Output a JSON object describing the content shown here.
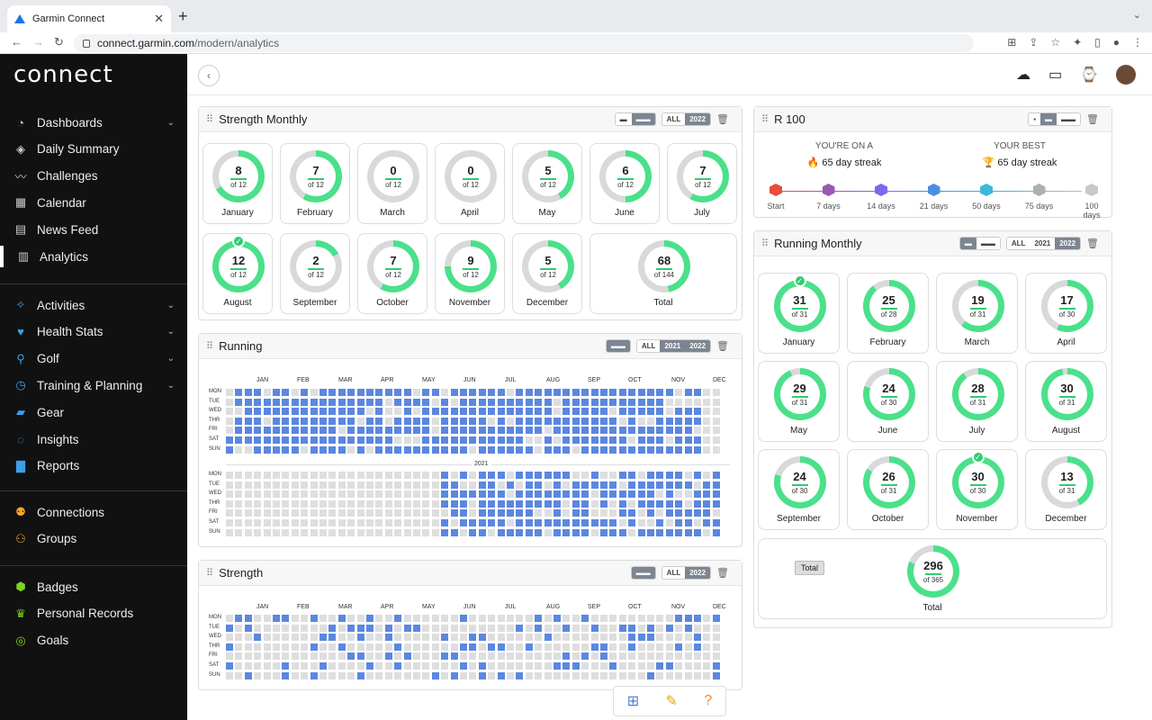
{
  "browser": {
    "tab_title": "Garmin Connect",
    "url_host": "connect.garmin.com",
    "url_path": "/modern/analytics"
  },
  "sidebar": {
    "logo": "connect",
    "groups": [
      [
        {
          "label": "Dashboards",
          "icon": "dashboards-icon",
          "glyph": "◔",
          "chev": true
        },
        {
          "label": "Daily Summary",
          "icon": "layers-icon",
          "glyph": "◈"
        },
        {
          "label": "Challenges",
          "icon": "challenges-icon",
          "glyph": "〰"
        },
        {
          "label": "Calendar",
          "icon": "calendar-icon",
          "glyph": "▦"
        },
        {
          "label": "News Feed",
          "icon": "newsfeed-icon",
          "glyph": "▤"
        },
        {
          "label": "Analytics",
          "icon": "analytics-icon",
          "glyph": "▥",
          "active": true
        }
      ],
      [
        {
          "label": "Activities",
          "icon": "activities-icon",
          "glyph": "✧",
          "chev": true,
          "color": "#3ba0e6"
        },
        {
          "label": "Health Stats",
          "icon": "heart-icon",
          "glyph": "♥",
          "chev": true,
          "color": "#3ba0e6"
        },
        {
          "label": "Golf",
          "icon": "golf-icon",
          "glyph": "⚲",
          "chev": true,
          "color": "#3ba0e6"
        },
        {
          "label": "Training & Planning",
          "icon": "stopwatch-icon",
          "glyph": "◷",
          "chev": true,
          "color": "#3ba0e6"
        },
        {
          "label": "Gear",
          "icon": "shoe-icon",
          "glyph": "▰",
          "color": "#3ba0e6"
        },
        {
          "label": "Insights",
          "icon": "bulb-icon",
          "glyph": "◌",
          "color": "#3ba0e6"
        },
        {
          "label": "Reports",
          "icon": "reports-icon",
          "glyph": "▇",
          "color": "#3ba0e6"
        }
      ],
      [
        {
          "label": "Connections",
          "icon": "connections-icon",
          "glyph": "⚉",
          "color": "#f5a623"
        },
        {
          "label": "Groups",
          "icon": "groups-icon",
          "glyph": "⚇",
          "color": "#f5a623"
        }
      ],
      [
        {
          "label": "Badges",
          "icon": "badge-icon",
          "glyph": "⬢",
          "color": "#7ed321"
        },
        {
          "label": "Personal Records",
          "icon": "trophy-icon",
          "glyph": "♛",
          "color": "#7ed321"
        },
        {
          "label": "Goals",
          "icon": "goal-icon",
          "glyph": "◎",
          "color": "#7ed321"
        }
      ]
    ]
  },
  "strength_monthly": {
    "title": "Strength Monthly",
    "seg": [
      "ALL",
      "2022"
    ],
    "months": [
      {
        "m": "January",
        "v": 8,
        "of": 12
      },
      {
        "m": "February",
        "v": 7,
        "of": 12
      },
      {
        "m": "March",
        "v": 0,
        "of": 12
      },
      {
        "m": "April",
        "v": 0,
        "of": 12
      },
      {
        "m": "May",
        "v": 5,
        "of": 12
      },
      {
        "m": "June",
        "v": 6,
        "of": 12
      },
      {
        "m": "July",
        "v": 7,
        "of": 12
      },
      {
        "m": "August",
        "v": 12,
        "of": 12,
        "check": true
      },
      {
        "m": "September",
        "v": 2,
        "of": 12
      },
      {
        "m": "October",
        "v": 7,
        "of": 12
      },
      {
        "m": "November",
        "v": 9,
        "of": 12
      },
      {
        "m": "December",
        "v": 5,
        "of": 12
      }
    ],
    "total": {
      "label": "Total",
      "v": 68,
      "of": 144
    }
  },
  "running": {
    "title": "Running",
    "seg": [
      "ALL",
      "2021",
      "2022"
    ],
    "year_label": "2021"
  },
  "strength": {
    "title": "Strength",
    "seg": [
      "ALL",
      "2022"
    ]
  },
  "calendar": {
    "months": [
      "JAN",
      "FEB",
      "MAR",
      "APR",
      "MAY",
      "JUN",
      "JUL",
      "AUG",
      "SEP",
      "OCT",
      "NOV",
      "DEC"
    ],
    "days": [
      "MON",
      "TUE",
      "WED",
      "THR",
      "FRI",
      "SAT",
      "SUN"
    ]
  },
  "r100": {
    "title": "R 100",
    "current_head": "YOU'RE ON A",
    "current": "65 day streak",
    "best_head": "YOUR BEST",
    "best": "65 day streak",
    "milestones": [
      {
        "l": "Start",
        "c": "#e74c3c"
      },
      {
        "l": "7 days",
        "c": "#9b59b6"
      },
      {
        "l": "14 days",
        "c": "#7b68ee"
      },
      {
        "l": "21 days",
        "c": "#4a90e2"
      },
      {
        "l": "50 days",
        "c": "#3cb8d8"
      },
      {
        "l": "75 days",
        "c": "#b0b0b0"
      },
      {
        "l": "100 days",
        "c": "#c8c8c8"
      }
    ]
  },
  "running_monthly": {
    "title": "Running Monthly",
    "seg": [
      "ALL",
      "2021",
      "2022"
    ],
    "months": [
      {
        "m": "January",
        "v": 31,
        "of": 31,
        "check": true
      },
      {
        "m": "February",
        "v": 25,
        "of": 28
      },
      {
        "m": "March",
        "v": 19,
        "of": 31
      },
      {
        "m": "April",
        "v": 17,
        "of": 30
      },
      {
        "m": "May",
        "v": 29,
        "of": 31
      },
      {
        "m": "June",
        "v": 24,
        "of": 30
      },
      {
        "m": "July",
        "v": 28,
        "of": 31
      },
      {
        "m": "August",
        "v": 30,
        "of": 31
      },
      {
        "m": "September",
        "v": 24,
        "of": 30
      },
      {
        "m": "October",
        "v": 26,
        "of": 31
      },
      {
        "m": "November",
        "v": 30,
        "of": 30,
        "check": true
      },
      {
        "m": "December",
        "v": 13,
        "of": 31
      }
    ],
    "total": {
      "label": "Total",
      "v": 296,
      "of": 365,
      "tooltip": "Total"
    }
  },
  "colors": {
    "ring": "#4be08a",
    "ring_bg": "#d9d9d9",
    "active_day": "#5b87e0",
    "inactive_day": "#dedede"
  }
}
